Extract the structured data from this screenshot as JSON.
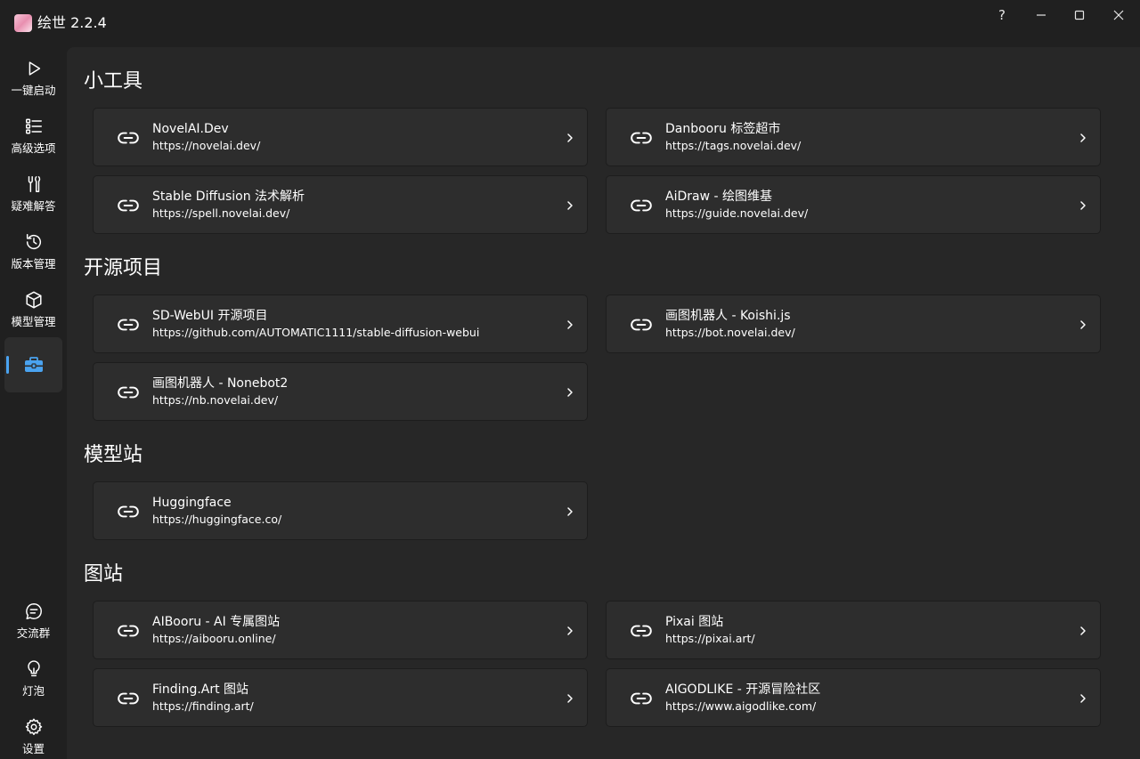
{
  "window": {
    "title": "绘世 2.2.4",
    "help_label": "?",
    "logo_icon": "app-logo-icon"
  },
  "sidebar": {
    "items": [
      {
        "label": "一键启动",
        "icon": "play-icon"
      },
      {
        "label": "高级选项",
        "icon": "list-icon"
      },
      {
        "label": "疑难解答",
        "icon": "tools-icon"
      },
      {
        "label": "版本管理",
        "icon": "history-icon"
      },
      {
        "label": "模型管理",
        "icon": "cube-icon"
      },
      {
        "label": "",
        "icon": "toolbox-icon",
        "active": true
      }
    ],
    "bottom_items": [
      {
        "label": "交流群",
        "icon": "chat-icon"
      },
      {
        "label": "灯泡",
        "icon": "lightbulb-icon"
      },
      {
        "label": "设置",
        "icon": "gear-icon"
      }
    ],
    "accent_color": "#4aa3f0"
  },
  "sections": [
    {
      "title": "小工具",
      "cards": [
        {
          "title": "NovelAI.Dev",
          "url": "https://novelai.dev/"
        },
        {
          "title": "Danbooru 标签超市",
          "url": "https://tags.novelai.dev/"
        },
        {
          "title": "Stable Diffusion 法术解析",
          "url": "https://spell.novelai.dev/"
        },
        {
          "title": "AiDraw - 绘图维基",
          "url": "https://guide.novelai.dev/"
        }
      ]
    },
    {
      "title": "开源项目",
      "cards": [
        {
          "title": "SD-WebUI 开源项目",
          "url": "https://github.com/AUTOMATIC1111/stable-diffusion-webui"
        },
        {
          "title": "画图机器人 - Koishi.js",
          "url": "https://bot.novelai.dev/"
        },
        {
          "title": "画图机器人 - Nonebot2",
          "url": "https://nb.novelai.dev/"
        }
      ]
    },
    {
      "title": "模型站",
      "cards": [
        {
          "title": "Huggingface",
          "url": "https://huggingface.co/"
        }
      ]
    },
    {
      "title": "图站",
      "cards": [
        {
          "title": "AIBooru - AI 专属图站",
          "url": "https://aibooru.online/"
        },
        {
          "title": "Pixai 图站",
          "url": "https://pixai.art/"
        },
        {
          "title": "Finding.Art 图站",
          "url": "https://finding.art/"
        },
        {
          "title": "AIGODLIKE - 开源冒险社区",
          "url": "https://www.aigodlike.com/"
        }
      ]
    }
  ]
}
